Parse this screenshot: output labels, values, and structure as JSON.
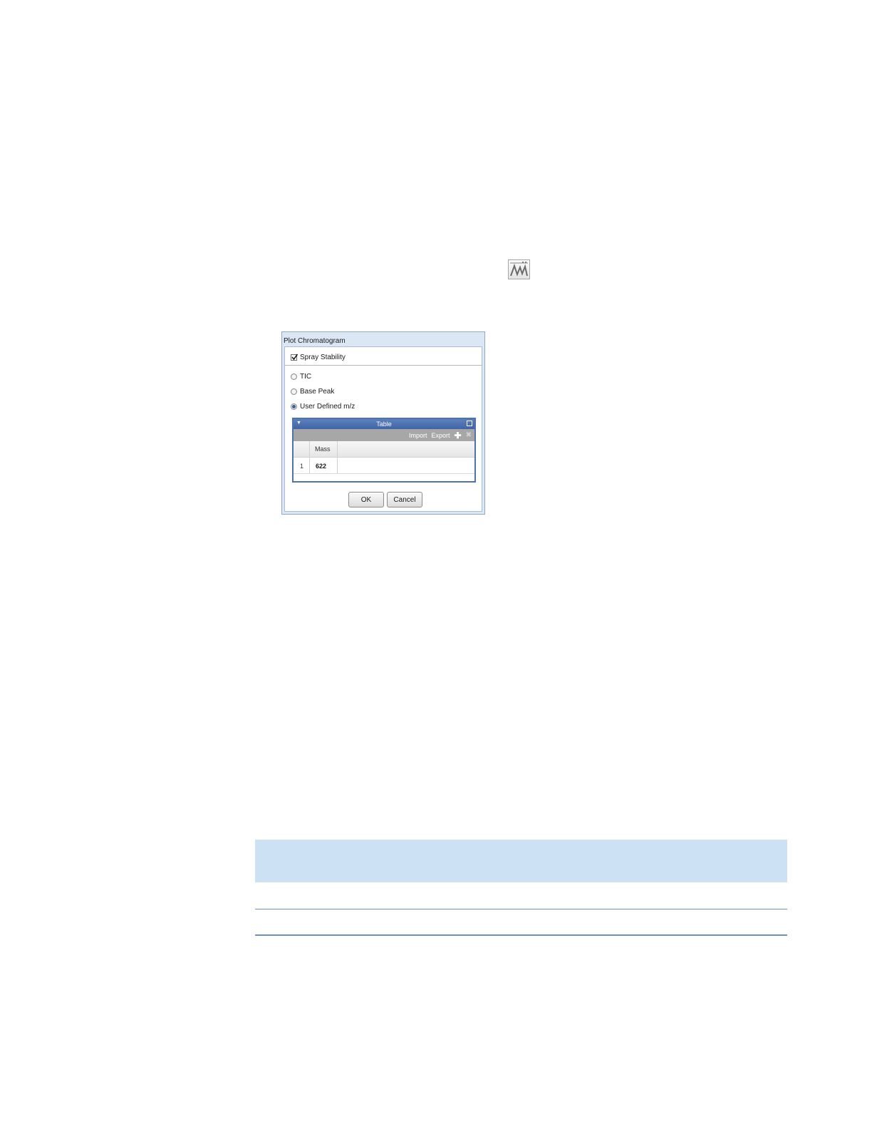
{
  "toolbar_icon": {
    "icon": "chromatogram-plot-icon"
  },
  "dialog": {
    "title": "Plot Chromatogram",
    "spray_stability": {
      "label": "Spray Stability",
      "checked": true
    },
    "options": [
      {
        "label": "TIC",
        "selected": false
      },
      {
        "label": "Base Peak",
        "selected": false
      },
      {
        "label": "User Defined m/z",
        "selected": true
      }
    ],
    "table_panel": {
      "title": "Table",
      "import_label": "Import",
      "export_label": "Export",
      "columns": [
        "Mass"
      ],
      "rows": [
        {
          "index": "1",
          "mass": "622"
        }
      ]
    },
    "ok_label": "OK",
    "cancel_label": "Cancel"
  },
  "colors": {
    "panel_header": "#4a6eaf",
    "note_band": "#cce1f4",
    "rule": "#6e8fc2"
  }
}
